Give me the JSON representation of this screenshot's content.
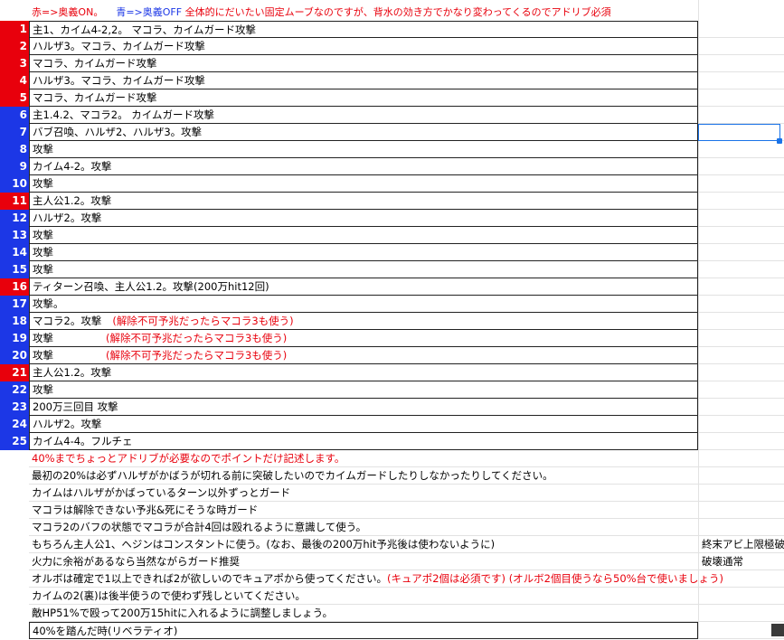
{
  "header": {
    "part1": "赤=>奥義ON。",
    "part2": "青=>奥義OFF",
    "part3": "全体的にだいたい固定ムーブなのですが、背水の効き方でかなり変わってくるのでアドリブ必須"
  },
  "turns": [
    {
      "num": "1",
      "color": "red",
      "text": "主1、カイム4-2,2。 マコラ、カイムガード攻撃",
      "note": ""
    },
    {
      "num": "2",
      "color": "red",
      "text": "ハルザ3。マコラ、カイムガード攻撃",
      "note": ""
    },
    {
      "num": "3",
      "color": "red",
      "text": "マコラ、カイムガード攻撃",
      "note": ""
    },
    {
      "num": "4",
      "color": "red",
      "text": "ハルザ3。マコラ、カイムガード攻撃",
      "note": ""
    },
    {
      "num": "5",
      "color": "red",
      "text": "マコラ、カイムガード攻撃",
      "note": ""
    },
    {
      "num": "6",
      "color": "blue",
      "text": "主1.4.2、マコラ2。 カイムガード攻撃",
      "note": ""
    },
    {
      "num": "7",
      "color": "blue",
      "text": "バブ召喚、ハルザ2、ハルザ3。攻撃",
      "note": ""
    },
    {
      "num": "8",
      "color": "blue",
      "text": "攻撃",
      "note": ""
    },
    {
      "num": "9",
      "color": "blue",
      "text": "カイム4-2。攻撃",
      "note": ""
    },
    {
      "num": "10",
      "color": "blue",
      "text": "攻撃",
      "note": ""
    },
    {
      "num": "11",
      "color": "red",
      "text": "主人公1.2。攻撃",
      "note": ""
    },
    {
      "num": "12",
      "color": "blue",
      "text": "ハルザ2。攻撃",
      "note": ""
    },
    {
      "num": "13",
      "color": "blue",
      "text": "攻撃",
      "note": ""
    },
    {
      "num": "14",
      "color": "blue",
      "text": "攻撃",
      "note": ""
    },
    {
      "num": "15",
      "color": "blue",
      "text": "攻撃",
      "note": ""
    },
    {
      "num": "16",
      "color": "red",
      "text": "ティターン召喚、主人公1.2。攻撃(200万hit12回)",
      "note": ""
    },
    {
      "num": "17",
      "color": "blue",
      "text": "攻撃。",
      "note": ""
    },
    {
      "num": "18",
      "color": "blue",
      "text": "マコラ2。攻撃",
      "note": "(解除不可予兆だったらマコラ3も使う)"
    },
    {
      "num": "19",
      "color": "blue",
      "text": "攻撃",
      "note": "(解除不可予兆だったらマコラ3も使う)"
    },
    {
      "num": "20",
      "color": "blue",
      "text": "攻撃",
      "note": "(解除不可予兆だったらマコラ3も使う)"
    },
    {
      "num": "21",
      "color": "red",
      "text": "主人公1.2。攻撃",
      "note": ""
    },
    {
      "num": "22",
      "color": "blue",
      "text": "攻撃",
      "note": ""
    },
    {
      "num": "23",
      "color": "blue",
      "text": "200万三回目 攻撃",
      "note": ""
    },
    {
      "num": "24",
      "color": "blue",
      "text": "ハルザ2。攻撃",
      "note": ""
    },
    {
      "num": "25",
      "color": "blue",
      "text": "カイム4-4。フルチェ",
      "note": ""
    }
  ],
  "notes": [
    {
      "text": "40%までちょっとアドリブが必要なのでポイントだけ記述します。",
      "red": "",
      "side": ""
    },
    {
      "text": "最初の20%は必ずハルザがかばうが切れる前に突破したいのでカイムガードしたりしなかったりしてください。",
      "red": "",
      "side": ""
    },
    {
      "text": "カイムはハルザがかばっているターン以外ずっとガード",
      "red": "",
      "side": ""
    },
    {
      "text": "マコラは解除できない予兆&死にそうな時ガード",
      "red": "",
      "side": ""
    },
    {
      "text": "マコラ2のバフの状態でマコラが合計4回は殴れるように意識して使う。",
      "red": "",
      "side": ""
    },
    {
      "text": "もちろん主人公1、ヘジンはコンスタントに使う。(なお、最後の200万hit予兆後は使わないように)",
      "red": "",
      "side": "終末アビ上限極破"
    },
    {
      "text": "火力に余裕があるなら当然ながらガード推奨",
      "red": "",
      "side": "破壊通常"
    },
    {
      "text": "オルボは確定で1以上できれば2が欲しいのでキュアポから使ってください。",
      "red": "(キュアポ2個は必須です) (オルボ2個目使うなら50%台で使いましょう)",
      "side": ""
    },
    {
      "text": "カイムの2(裏)は後半使うので使わず残しといてください。",
      "red": "",
      "side": ""
    },
    {
      "text": "敵HP51%で殴って200万15hitに入れるように調整しましょう。",
      "red": "",
      "side": ""
    },
    {
      "text": "40%を踏んだ時(リベラティオ)",
      "red": "",
      "side": ""
    }
  ],
  "colors": {
    "red": "#e8000c",
    "blue": "#1c37e6"
  }
}
